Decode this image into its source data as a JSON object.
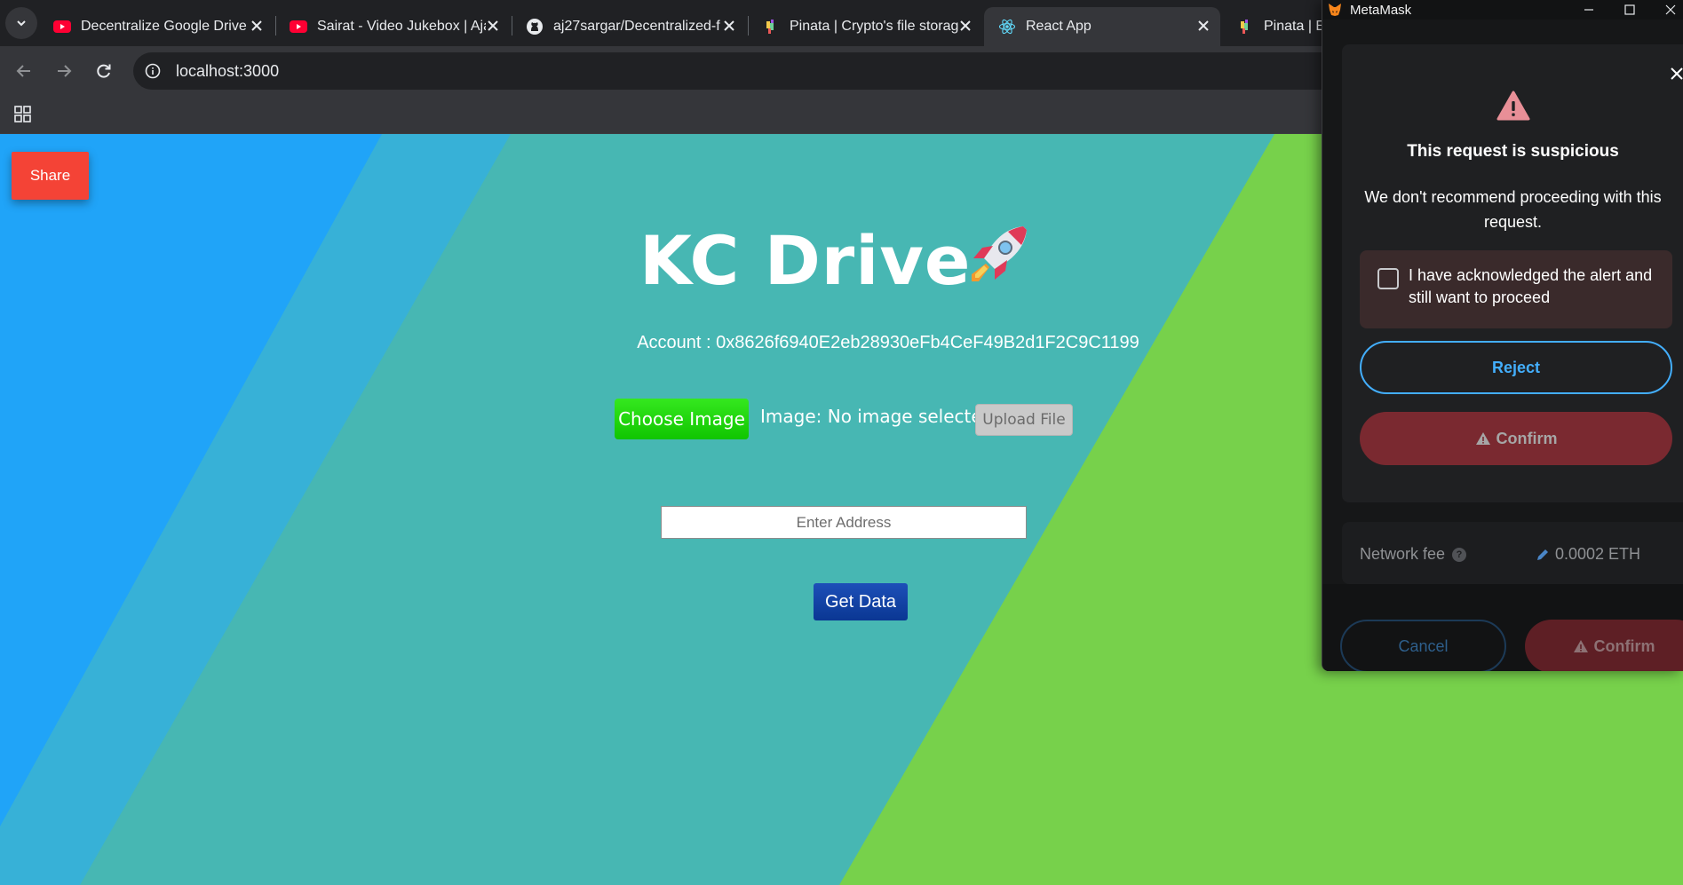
{
  "browser": {
    "tabs": [
      {
        "title": "Decentralize Google Drive",
        "icon": "youtube-icon",
        "active": false
      },
      {
        "title": "Sairat - Video Jukebox | Ajay",
        "icon": "youtube-icon",
        "active": false
      },
      {
        "title": "aj27sargar/Decentralized-f",
        "icon": "github-icon",
        "active": false
      },
      {
        "title": "Pinata | Crypto's file storage",
        "icon": "pinata-icon",
        "active": false
      },
      {
        "title": "React App",
        "icon": "react-icon",
        "active": true
      },
      {
        "title": "Pinata | Ef",
        "icon": "pinata-icon",
        "active": false
      }
    ],
    "url": "localhost:3000"
  },
  "page": {
    "share_label": "Share",
    "title": "KC Drive",
    "title_emoji": "rocket-icon",
    "account_text": "Account : 0x8626f6940E2eb28930eFb4CeF49B2d1F2C9C1199",
    "choose_label": "Choose Image",
    "image_status": "Image: No image selected",
    "upload_label": "Upload File",
    "address_placeholder": "Enter Address",
    "get_data_label": "Get Data",
    "colors": {
      "blue": "#20a4f8",
      "teal": "#47b7b3",
      "green": "#77d14b",
      "share": "#f44336"
    }
  },
  "metamask": {
    "window_title": "MetaMask",
    "heading": "This request is suspicious",
    "description": "We don't recommend proceeding with this request.",
    "acknowledge_text": "I have acknowledged the alert and still want to proceed",
    "acknowledged": false,
    "reject_label": "Reject",
    "confirm_label": "Confirm",
    "network_fee_label": "Network fee",
    "network_fee_value": "0.0002 ETH",
    "cancel_label": "Cancel",
    "confirm_footer_label": "Confirm"
  }
}
